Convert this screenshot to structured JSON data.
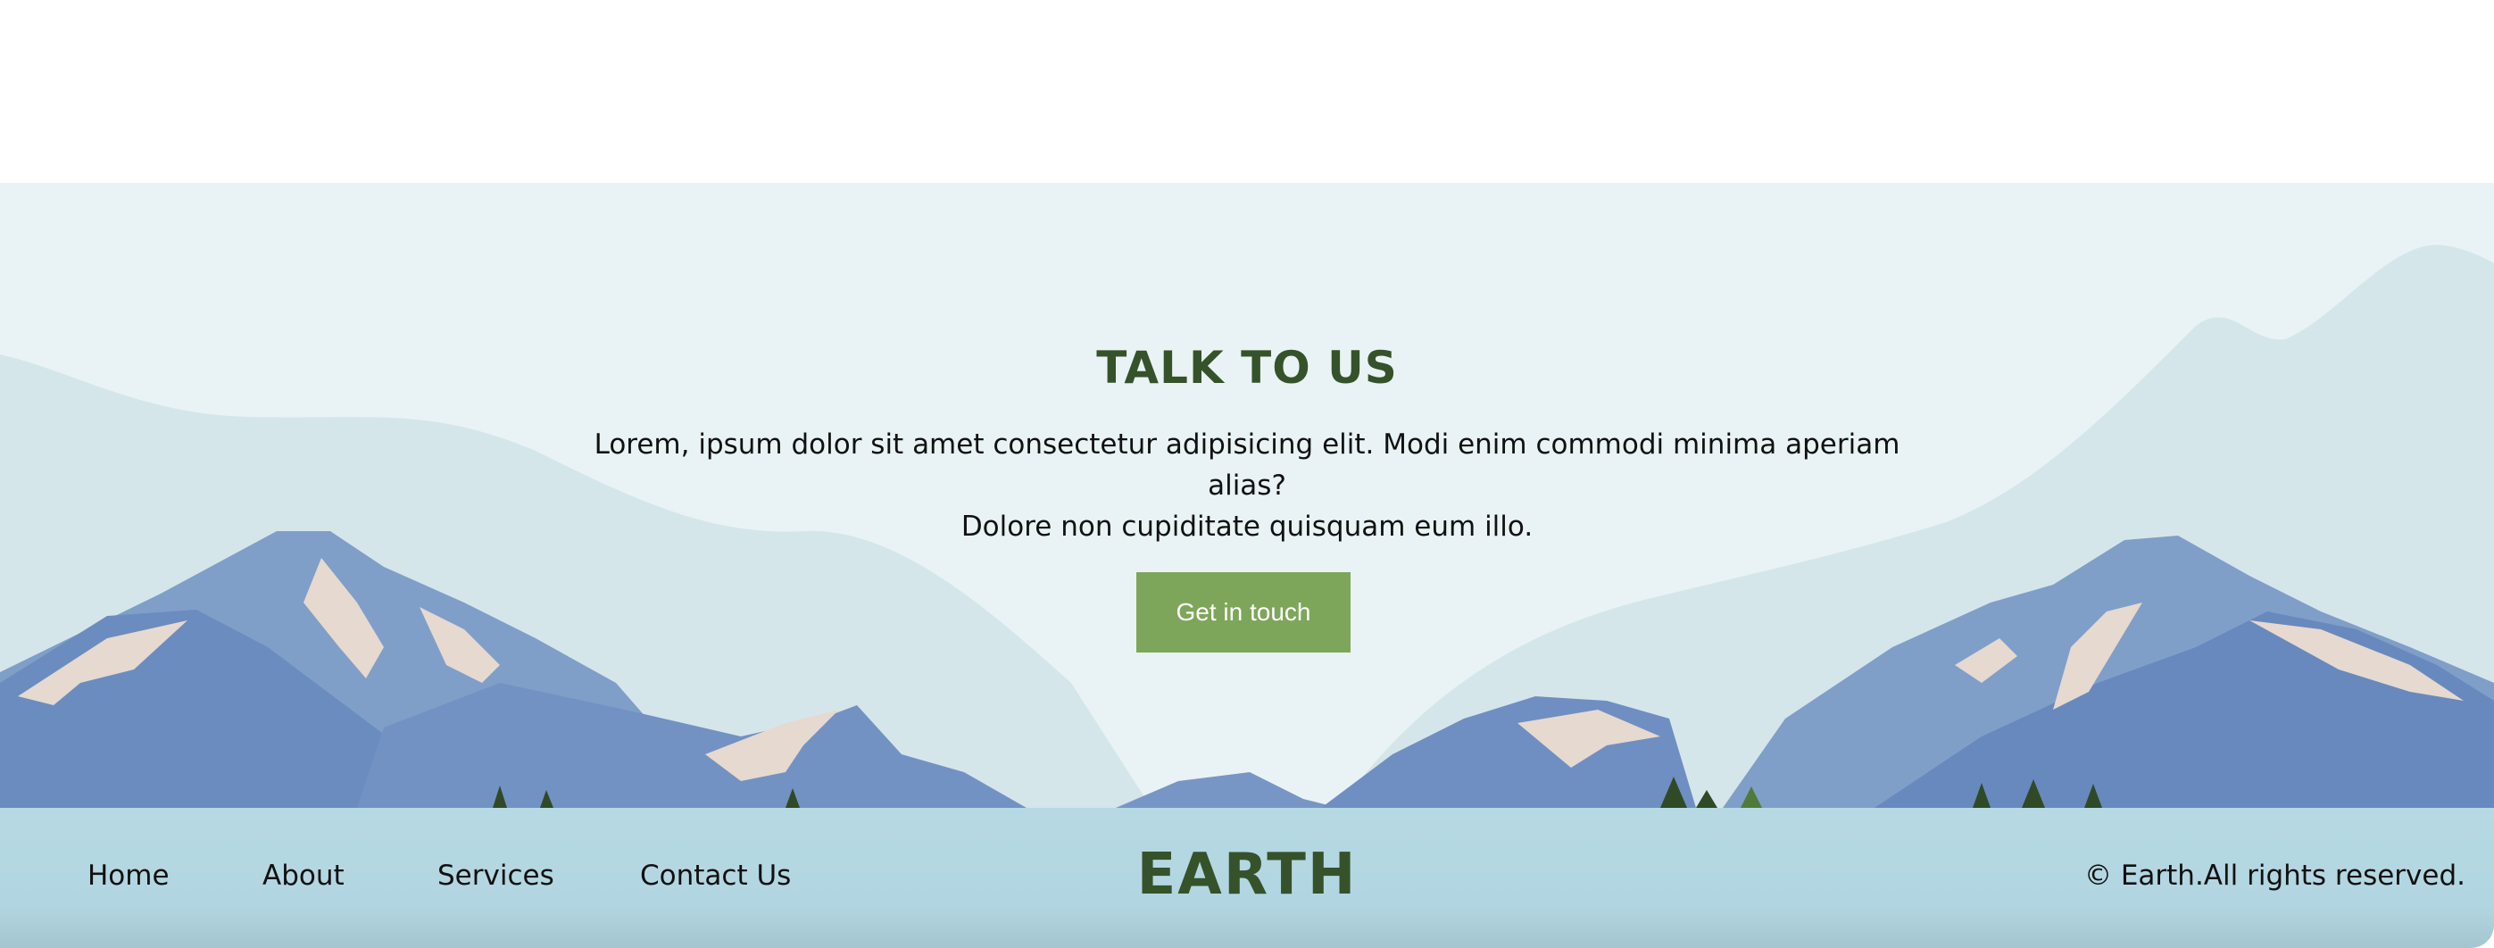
{
  "hero": {
    "title": "TALK TO US",
    "text_line1": "Lorem, ipsum dolor sit amet consectetur adipisicing elit. Modi enim commodi minima aperiam alias?",
    "text_line2": "Dolore non cupiditate quisquam eum illo.",
    "button_label": "Get in touch",
    "background_color": "#e9f3f5",
    "button_color": "#7ea65a"
  },
  "footer": {
    "nav": [
      "Home",
      "About",
      "Services",
      "Contact Us"
    ],
    "brand": "EARTH",
    "copyright": "© Earth.All rights reserved.",
    "brand_color": "#35522a",
    "background_color": "#b6d9e3"
  }
}
